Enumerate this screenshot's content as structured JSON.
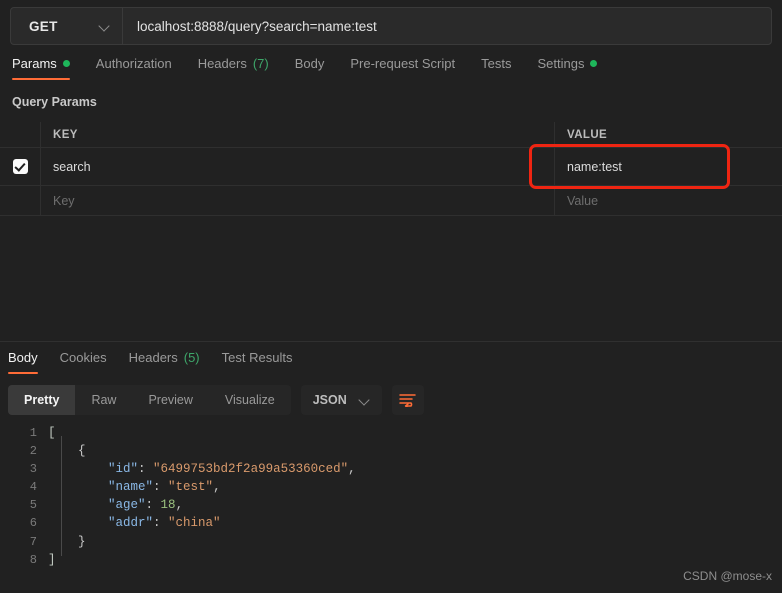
{
  "request": {
    "method": "GET",
    "url": "localhost:8888/query?search=name:test",
    "method_caret": "chevron-down-icon"
  },
  "request_tabs": [
    {
      "label": "Params",
      "active": true,
      "dot": true
    },
    {
      "label": "Authorization",
      "active": false,
      "dot": false
    },
    {
      "label": "Headers",
      "count": "(7)",
      "active": false,
      "dot": false
    },
    {
      "label": "Body",
      "active": false,
      "dot": false
    },
    {
      "label": "Pre-request Script",
      "active": false,
      "dot": false
    },
    {
      "label": "Tests",
      "active": false,
      "dot": false
    },
    {
      "label": "Settings",
      "active": false,
      "dot": true
    }
  ],
  "params": {
    "section_title": "Query Params",
    "headers": {
      "key": "KEY",
      "value": "VALUE"
    },
    "rows": [
      {
        "checked": true,
        "key": "search",
        "value": "name:test"
      }
    ],
    "placeholder_row": {
      "key": "Key",
      "value": "Value"
    }
  },
  "response_tabs": [
    {
      "label": "Body",
      "active": true
    },
    {
      "label": "Cookies",
      "active": false
    },
    {
      "label": "Headers",
      "count": "(5)",
      "active": false
    },
    {
      "label": "Test Results",
      "active": false
    }
  ],
  "format_bar": {
    "segments": [
      {
        "label": "Pretty",
        "active": true
      },
      {
        "label": "Raw",
        "active": false
      },
      {
        "label": "Preview",
        "active": false
      },
      {
        "label": "Visualize",
        "active": false
      }
    ],
    "language": "JSON",
    "language_caret": "chevron-down-icon",
    "wrap_icon": "wrap-lines-icon"
  },
  "response_body": {
    "language": "json",
    "lines": [
      {
        "n": "1",
        "tokens": [
          {
            "t": "[",
            "c": "br"
          }
        ]
      },
      {
        "n": "2",
        "tokens": [
          {
            "t": "    {",
            "c": "p"
          }
        ]
      },
      {
        "n": "3",
        "tokens": [
          {
            "t": "        ",
            "c": "p"
          },
          {
            "t": "\"id\"",
            "c": "k"
          },
          {
            "t": ": ",
            "c": "p"
          },
          {
            "t": "\"6499753bd2f2a99a53360ced\"",
            "c": "s"
          },
          {
            "t": ",",
            "c": "p"
          }
        ]
      },
      {
        "n": "4",
        "tokens": [
          {
            "t": "        ",
            "c": "p"
          },
          {
            "t": "\"name\"",
            "c": "k"
          },
          {
            "t": ": ",
            "c": "p"
          },
          {
            "t": "\"test\"",
            "c": "s"
          },
          {
            "t": ",",
            "c": "p"
          }
        ]
      },
      {
        "n": "5",
        "tokens": [
          {
            "t": "        ",
            "c": "p"
          },
          {
            "t": "\"age\"",
            "c": "k"
          },
          {
            "t": ": ",
            "c": "p"
          },
          {
            "t": "18",
            "c": "n"
          },
          {
            "t": ",",
            "c": "p"
          }
        ]
      },
      {
        "n": "6",
        "tokens": [
          {
            "t": "        ",
            "c": "p"
          },
          {
            "t": "\"addr\"",
            "c": "k"
          },
          {
            "t": ": ",
            "c": "p"
          },
          {
            "t": "\"china\"",
            "c": "s"
          }
        ]
      },
      {
        "n": "7",
        "tokens": [
          {
            "t": "    }",
            "c": "p"
          }
        ]
      },
      {
        "n": "8",
        "tokens": [
          {
            "t": "]",
            "c": "br"
          }
        ]
      }
    ],
    "parsed": [
      {
        "id": "6499753bd2f2a99a53360ced",
        "name": "test",
        "age": 18,
        "addr": "china"
      }
    ]
  },
  "annotation": {
    "shape": "rectangle",
    "color": "#ef2512",
    "targets": "params-value-cell"
  },
  "watermark": "CSDN @mose-x",
  "colors": {
    "accent": "#ff6c37",
    "success": "#1eb65a",
    "background": "#212121",
    "panel": "#2a2a2a",
    "annotation": "#ef2512"
  }
}
